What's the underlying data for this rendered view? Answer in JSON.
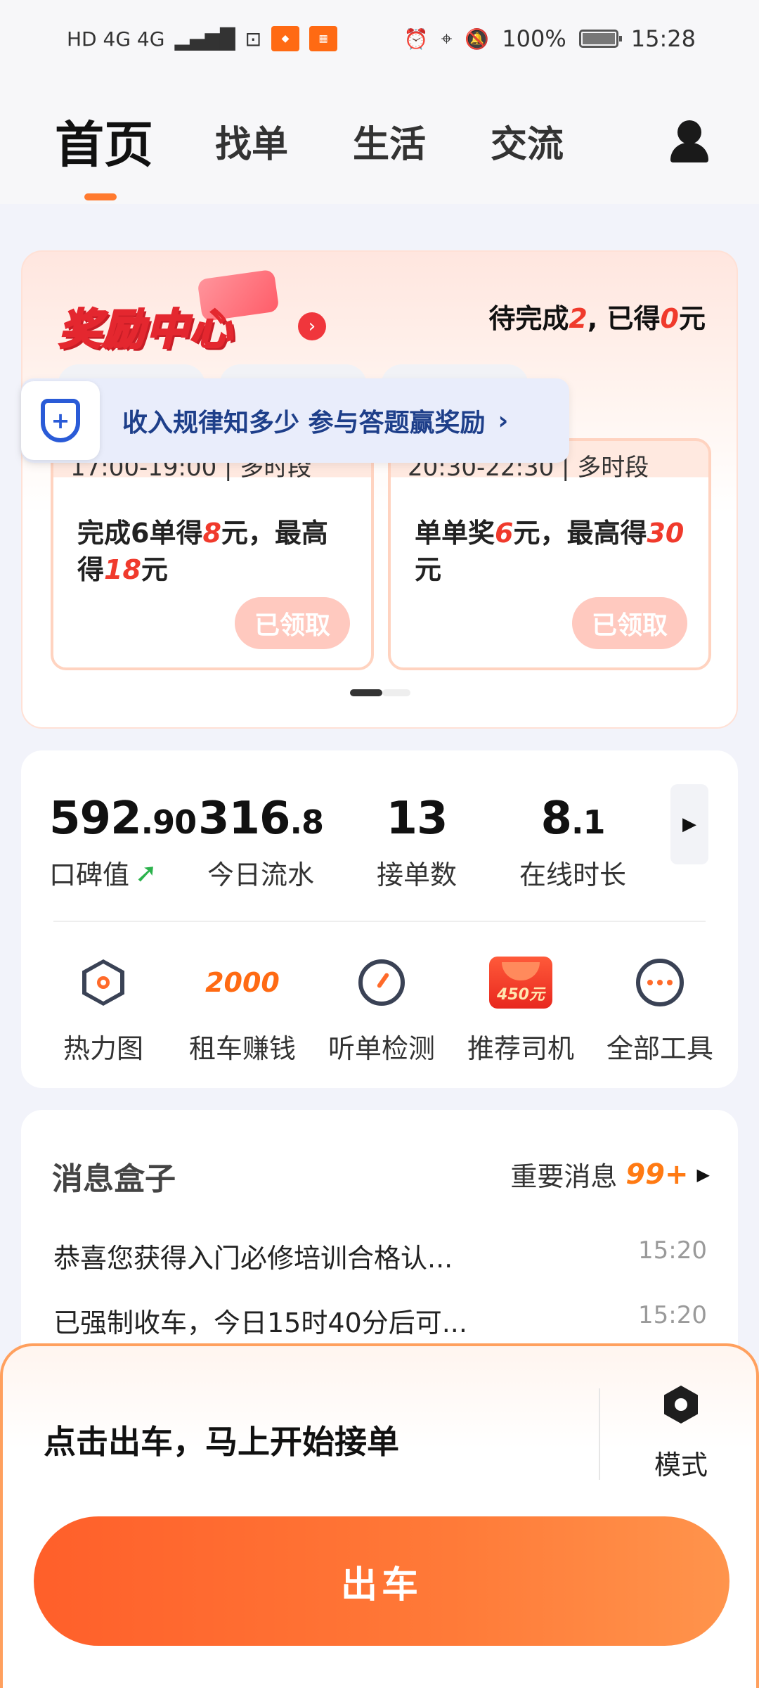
{
  "status_bar": {
    "net_left": "HD 4G 4G",
    "battery": "100%",
    "time": "15:28"
  },
  "nav": {
    "tabs": [
      "首页",
      "找单",
      "生活",
      "交流"
    ]
  },
  "reward_center": {
    "logo": "奖励中心",
    "status_prefix": "待完成",
    "pending": "2",
    "status_mid": ", 已得",
    "earned": "0",
    "status_suffix": "元",
    "items": [
      {
        "time": "17:00-19:00 | 多时段",
        "desc_a": "完成6单得",
        "hi1": "8",
        "desc_b": "元，最高得",
        "hi2": "18",
        "desc_c": "元",
        "button": "已领取"
      },
      {
        "time": "20:30-22:30 | 多时段",
        "desc_a": "单单奖",
        "hi1": "6",
        "desc_b": "元，最高得",
        "hi2": "30",
        "desc_c": "元",
        "button": "已领取"
      }
    ],
    "tooltip": "收入规律知多少 参与答题赢奖励"
  },
  "stats": {
    "items": [
      {
        "int": "592",
        "dec": ".90",
        "label": "口碑值"
      },
      {
        "int": "316",
        "dec": ".8",
        "label": "今日流水"
      },
      {
        "int": "13",
        "dec": "",
        "label": "接单数"
      },
      {
        "int": "8",
        "dec": ".1",
        "label": "在线时长"
      }
    ]
  },
  "tools": {
    "items": [
      {
        "label": "热力图",
        "icon": "heatmap-icon"
      },
      {
        "label": "租车赚钱",
        "icon": "rent-car-icon",
        "badge": "2000"
      },
      {
        "label": "听单检测",
        "icon": "gauge-icon"
      },
      {
        "label": "推荐司机",
        "icon": "red-packet-icon",
        "badge": "450元"
      },
      {
        "label": "全部工具",
        "icon": "more-icon"
      }
    ]
  },
  "messages": {
    "title": "消息盒子",
    "important_label": "重要消息",
    "important_count": "99+",
    "items": [
      {
        "text": "恭喜您获得入门必修培训合格认...",
        "time": "15:20"
      },
      {
        "text": "已强制收车，今日15时40分后可...",
        "time": "15:20"
      }
    ]
  },
  "bottom": {
    "prompt": "点击出车，马上开始接单",
    "mode_label": "模式",
    "go_button": "出车"
  },
  "colors": {
    "accent": "#ff6a2a",
    "highlight_red": "#f03a2c",
    "up_green": "#2bb24c"
  }
}
